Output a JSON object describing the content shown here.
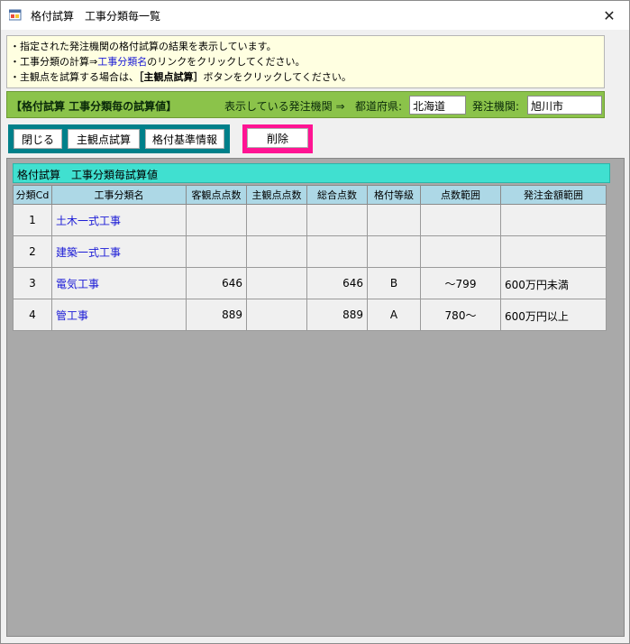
{
  "window": {
    "title": "格付試算　工事分類毎一覧",
    "close_glyph": "✕"
  },
  "info": {
    "line1": "・指定された発注機関の格付試算の結果を表示しています。",
    "line2_prefix": "・工事分類の計算⇒",
    "line2_link": "工事分類名",
    "line2_suffix": "のリンクをクリックしてください。",
    "line3_prefix": "・主観点を試算する場合は、",
    "line3_bold": "［主観点試算］",
    "line3_suffix": "ボタンをクリックしてください。"
  },
  "header": {
    "title": "【格付試算 工事分類毎の試算値】",
    "showing_label": "表示している発注機関 ⇒",
    "prefecture_label": "都道府県:",
    "prefecture_value": "北海道",
    "agency_label": "発注機関:",
    "agency_value": "旭川市"
  },
  "toolbar": {
    "close_label": "閉じる",
    "subjective_label": "主観点試算",
    "rating_info_label": "格付基準情報",
    "delete_label": "削除"
  },
  "grid": {
    "caption": "格付試算　工事分類毎試算値",
    "columns": [
      "分類Cd",
      "工事分類名",
      "客観点点数",
      "主観点点数",
      "総合点数",
      "格付等級",
      "点数範囲",
      "発注金額範囲"
    ],
    "rows": [
      {
        "cd": "1",
        "name": "土木一式工事",
        "objective": "",
        "subjective": "",
        "total": "",
        "grade": "",
        "range": "",
        "amount": ""
      },
      {
        "cd": "2",
        "name": "建築一式工事",
        "objective": "",
        "subjective": "",
        "total": "",
        "grade": "",
        "range": "",
        "amount": ""
      },
      {
        "cd": "3",
        "name": "電気工事",
        "objective": "646",
        "subjective": "",
        "total": "646",
        "grade": "B",
        "range": "～799",
        "amount": "600万円未満"
      },
      {
        "cd": "4",
        "name": "管工事",
        "objective": "889",
        "subjective": "",
        "total": "889",
        "grade": "A",
        "range": "780～",
        "amount": "600万円以上"
      }
    ]
  },
  "colors": {
    "info_bg": "#ffffe1",
    "header_bg": "#8bc34a",
    "button_group_bg": "#00808a",
    "delete_frame": "#ff1493",
    "caption_bg": "#40e0d0",
    "column_header_bg": "#add8e6",
    "grid_bg": "#a9a9a9",
    "link": "#1a1ad6"
  }
}
